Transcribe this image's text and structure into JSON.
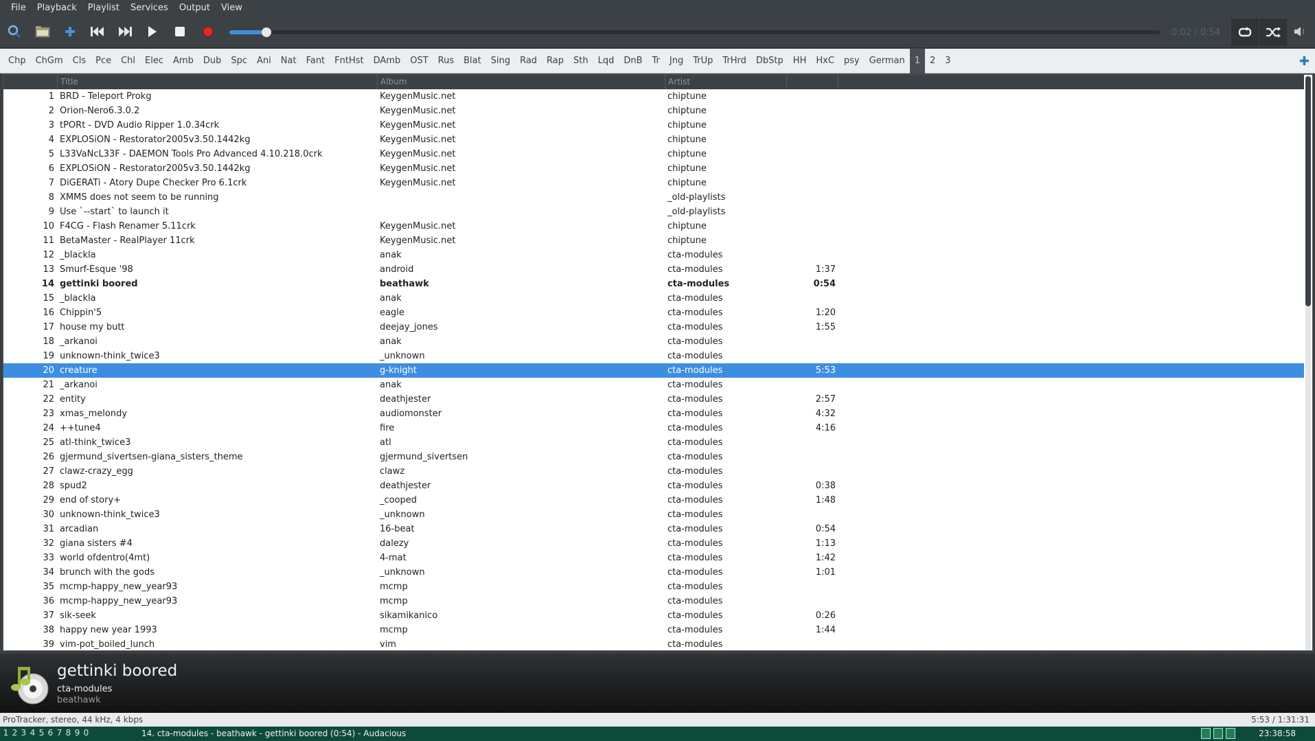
{
  "menu": [
    "File",
    "Playback",
    "Playlist",
    "Services",
    "Output",
    "View"
  ],
  "toolbar": {
    "time_readout": "0:02 / 0:54",
    "progress": 0.04,
    "icons": [
      "search-icon",
      "open-folder-icon",
      "add-icon",
      "previous-icon",
      "next-icon",
      "play-icon",
      "stop-icon",
      "record-icon",
      "repeat-icon",
      "shuffle-icon",
      "volume-icon"
    ]
  },
  "tabs": [
    "Chp",
    "ChGm",
    "Cls",
    "Pce",
    "Chl",
    "Elec",
    "Amb",
    "Dub",
    "Spc",
    "Ani",
    "Nat",
    "Fant",
    "FntHst",
    "DAmb",
    "OST",
    "Rus",
    "Blat",
    "Sing",
    "Rad",
    "Rap",
    "Sth",
    "Lqd",
    "DnB",
    "Tr",
    "Jng",
    "TrUp",
    "TrHrd",
    "DbStp",
    "HH",
    "HxC",
    "psy",
    "German",
    "1",
    "2",
    "3"
  ],
  "active_tab": "1",
  "columns": {
    "title": "Title",
    "album": "Album",
    "artist": "Artist"
  },
  "rows": [
    {
      "n": "1",
      "title": "BRD - Teleport Prokg",
      "album": "KeygenMusic.net",
      "artist": "chiptune",
      "len": ""
    },
    {
      "n": "2",
      "title": "Orion-Nero6.3.0.2",
      "album": "KeygenMusic.net",
      "artist": "chiptune",
      "len": ""
    },
    {
      "n": "3",
      "title": "tPORt - DVD Audio Ripper 1.0.34crk",
      "album": "KeygenMusic.net",
      "artist": "chiptune",
      "len": ""
    },
    {
      "n": "4",
      "title": "EXPLOSiON - Restorator2005v3.50.1442kg",
      "album": "KeygenMusic.net",
      "artist": "chiptune",
      "len": ""
    },
    {
      "n": "5",
      "title": "L33VaNcL33F - DAEMON Tools Pro Advanced 4.10.218.0crk",
      "album": "KeygenMusic.net",
      "artist": "chiptune",
      "len": ""
    },
    {
      "n": "6",
      "title": "EXPLOSiON - Restorator2005v3.50.1442kg",
      "album": "KeygenMusic.net",
      "artist": "chiptune",
      "len": ""
    },
    {
      "n": "7",
      "title": "DiGERATi - Atory Dupe Checker Pro 6.1crk",
      "album": "KeygenMusic.net",
      "artist": "chiptune",
      "len": ""
    },
    {
      "n": "8",
      "title": "XMMS does not seem to be running",
      "album": "",
      "artist": "_old-playlists",
      "len": ""
    },
    {
      "n": "9",
      "title": "Use `--start` to launch it",
      "album": "",
      "artist": "_old-playlists",
      "len": ""
    },
    {
      "n": "10",
      "title": "F4CG - Flash Renamer 5.11crk",
      "album": "KeygenMusic.net",
      "artist": "chiptune",
      "len": ""
    },
    {
      "n": "11",
      "title": "BetaMaster - RealPlayer 11crk",
      "album": "KeygenMusic.net",
      "artist": "chiptune",
      "len": ""
    },
    {
      "n": "12",
      "title": "_blackla",
      "album": "anak",
      "artist": "cta-modules",
      "len": ""
    },
    {
      "n": "13",
      "title": "Smurf-Esque '98",
      "album": "android",
      "artist": "cta-modules",
      "len": "1:37"
    },
    {
      "n": "14",
      "title": "gettinki boored",
      "album": "beathawk",
      "artist": "cta-modules",
      "len": "0:54"
    },
    {
      "n": "15",
      "title": "_blackla",
      "album": "anak",
      "artist": "cta-modules",
      "len": ""
    },
    {
      "n": "16",
      "title": "Chippin'5",
      "album": "eagle",
      "artist": "cta-modules",
      "len": "1:20"
    },
    {
      "n": "17",
      "title": "house my butt",
      "album": "deejay_jones",
      "artist": "cta-modules",
      "len": "1:55"
    },
    {
      "n": "18",
      "title": "_arkanoi",
      "album": "anak",
      "artist": "cta-modules",
      "len": ""
    },
    {
      "n": "19",
      "title": "unknown-think_twice3",
      "album": "_unknown",
      "artist": "cta-modules",
      "len": ""
    },
    {
      "n": "20",
      "title": "creature",
      "album": "g-knight",
      "artist": "cta-modules",
      "len": "5:53"
    },
    {
      "n": "21",
      "title": "_arkanoi",
      "album": "anak",
      "artist": "cta-modules",
      "len": ""
    },
    {
      "n": "22",
      "title": "entity",
      "album": "deathjester",
      "artist": "cta-modules",
      "len": "2:57"
    },
    {
      "n": "23",
      "title": "xmas_melondy",
      "album": "audiomonster",
      "artist": "cta-modules",
      "len": "4:32"
    },
    {
      "n": "24",
      "title": "++tune4",
      "album": "fire",
      "artist": "cta-modules",
      "len": "4:16"
    },
    {
      "n": "25",
      "title": "atl-think_twice3",
      "album": "atl",
      "artist": "cta-modules",
      "len": ""
    },
    {
      "n": "26",
      "title": "gjermund_sivertsen-giana_sisters_theme",
      "album": "gjermund_sivertsen",
      "artist": "cta-modules",
      "len": ""
    },
    {
      "n": "27",
      "title": "clawz-crazy_egg",
      "album": "clawz",
      "artist": "cta-modules",
      "len": ""
    },
    {
      "n": "28",
      "title": "spud2",
      "album": "deathjester",
      "artist": "cta-modules",
      "len": "0:38"
    },
    {
      "n": "29",
      "title": "end of story+",
      "album": "_cooped",
      "artist": "cta-modules",
      "len": "1:48"
    },
    {
      "n": "30",
      "title": "unknown-think_twice3",
      "album": "_unknown",
      "artist": "cta-modules",
      "len": ""
    },
    {
      "n": "31",
      "title": "arcadian",
      "album": "16-beat",
      "artist": "cta-modules",
      "len": "0:54"
    },
    {
      "n": "32",
      "title": "giana sisters #4",
      "album": "dalezy",
      "artist": "cta-modules",
      "len": "1:13"
    },
    {
      "n": "33",
      "title": "world ofdentro(4mt)",
      "album": "4-mat",
      "artist": "cta-modules",
      "len": "1:42"
    },
    {
      "n": "34",
      "title": "brunch with the gods",
      "album": "_unknown",
      "artist": "cta-modules",
      "len": "1:01"
    },
    {
      "n": "35",
      "title": "mcmp-happy_new_year93",
      "album": "mcmp",
      "artist": "cta-modules",
      "len": ""
    },
    {
      "n": "36",
      "title": "mcmp-happy_new_year93",
      "album": "mcmp",
      "artist": "cta-modules",
      "len": ""
    },
    {
      "n": "37",
      "title": "sik-seek",
      "album": "sikamikanico",
      "artist": "cta-modules",
      "len": "0:26"
    },
    {
      "n": "38",
      "title": "happy new year 1993",
      "album": "mcmp",
      "artist": "cta-modules",
      "len": "1:44"
    },
    {
      "n": "39",
      "title": "vim-pot_boiled_lunch",
      "album": "vim",
      "artist": "cta-modules",
      "len": ""
    }
  ],
  "selected_row": "20",
  "current_row": "14",
  "now_playing": {
    "title": "gettinki boored",
    "artist": "cta-modules",
    "album": "beathawk"
  },
  "status": {
    "left": "ProTracker, stereo, 44 kHz, 4 kbps",
    "right": "5:53 / 1:31:31"
  },
  "taskbar": {
    "workspaces": [
      "1",
      "2",
      "3",
      "4",
      "5",
      "6",
      "7",
      "8",
      "9",
      "0"
    ],
    "window_title": "14. cta-modules - beathawk - gettinki boored (0:54) - Audacious",
    "clock": "23:38:58"
  },
  "colors": {
    "accent": "#3d8ee0",
    "taskbar": "#0e4a3a"
  }
}
